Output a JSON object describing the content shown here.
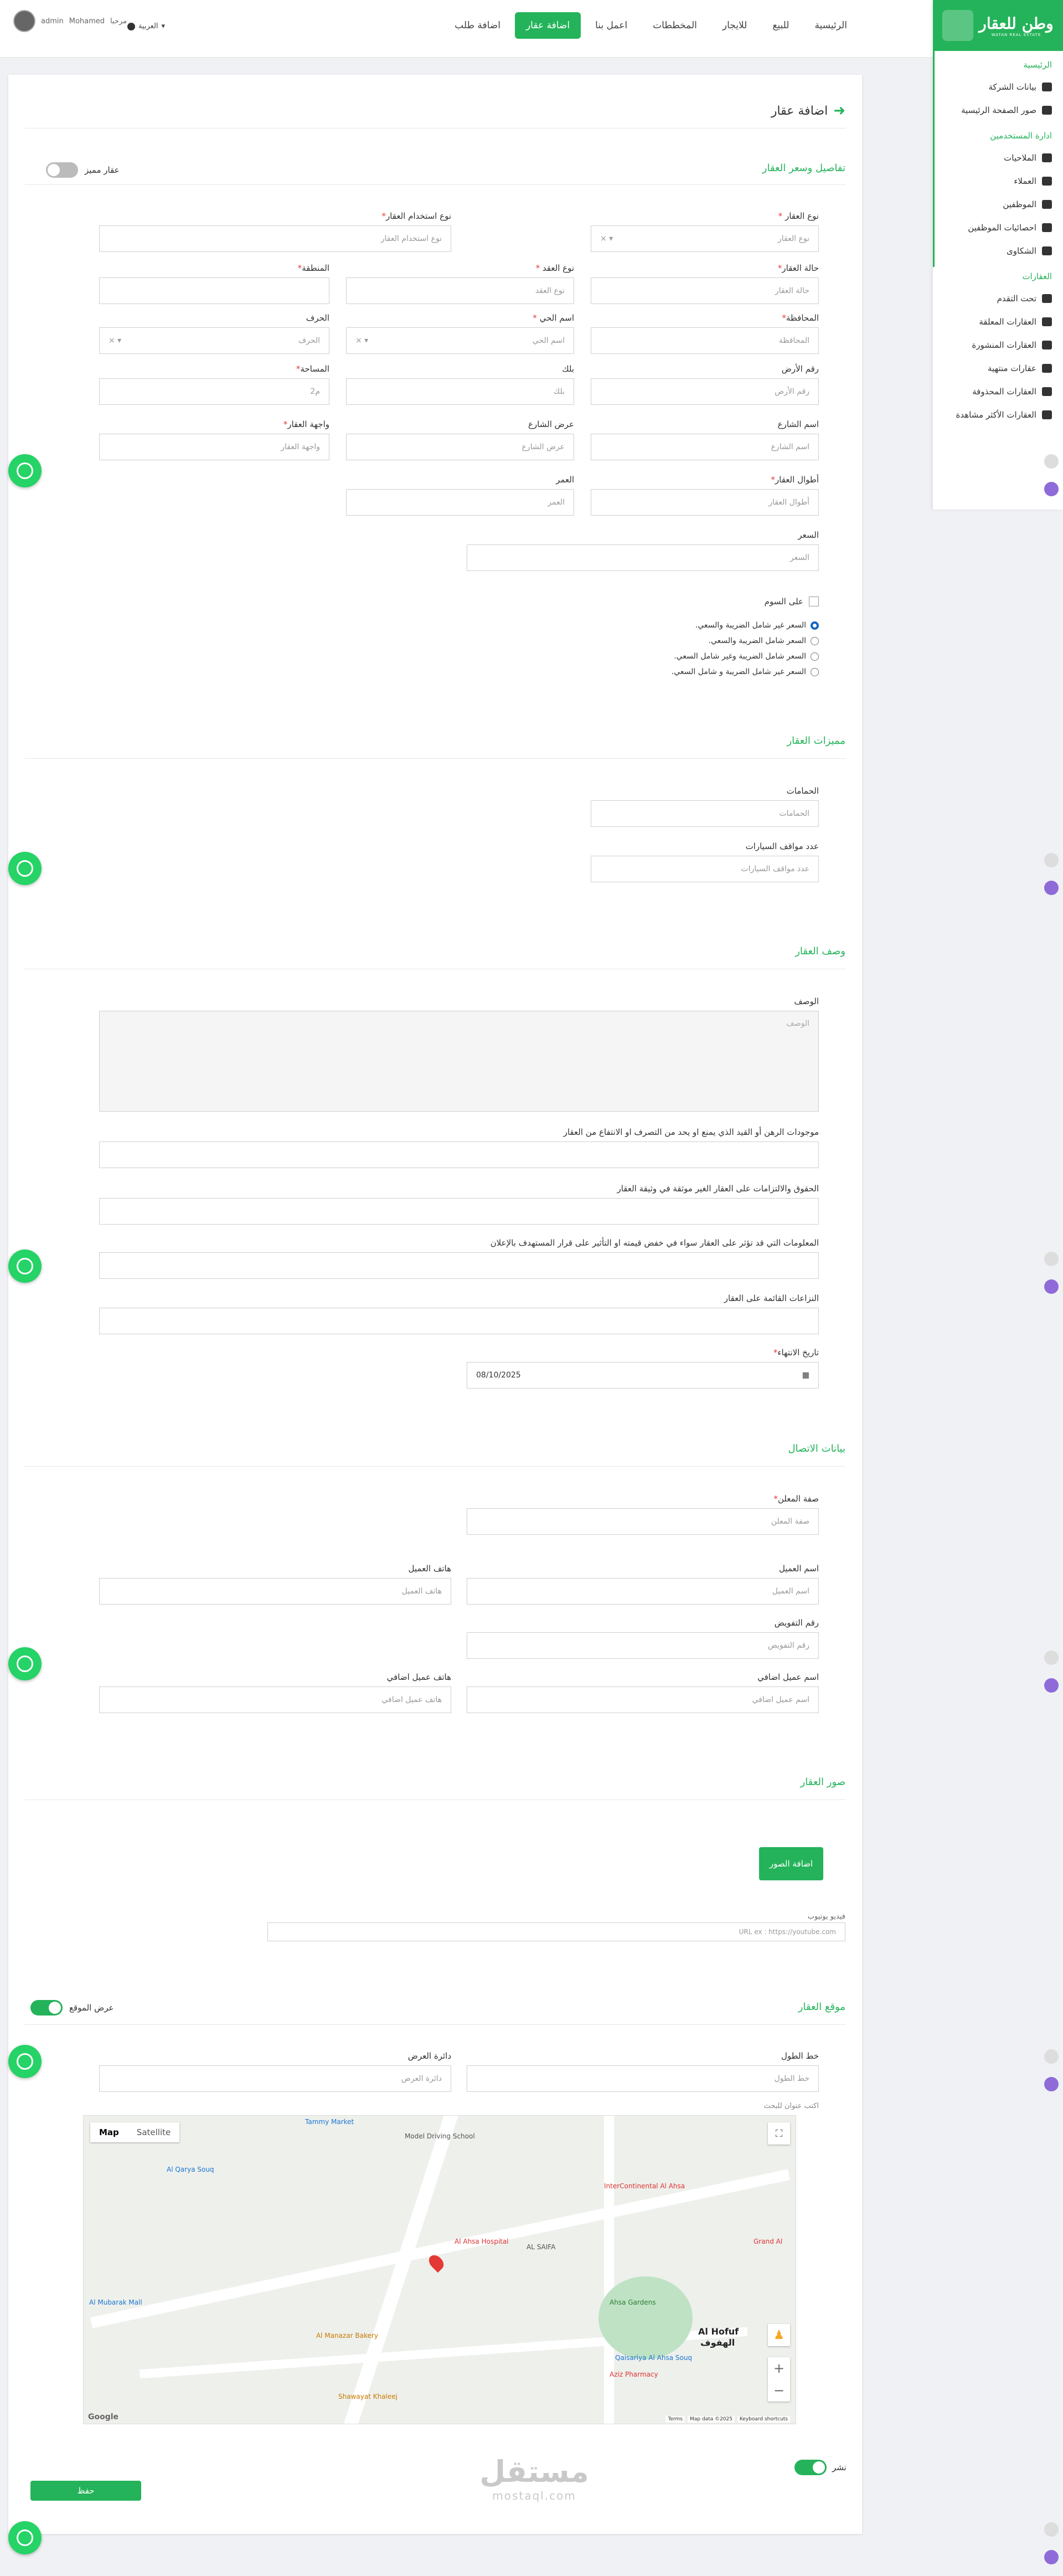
{
  "header": {
    "nav": [
      "الرئيسية",
      "للبيع",
      "للايجار",
      "المخططات",
      "اعمل بنا",
      "اضافة عقار",
      "اضافة طلب"
    ],
    "active_nav": "اضافة عقار",
    "user_greeting": "مرحبا",
    "user_name": "Mohamed",
    "user_role": "admin",
    "language": "العربية"
  },
  "sidebar": {
    "logo_text": "وطن للعقار",
    "logo_sub": "WATAN REAL ESTATE",
    "sections": [
      {
        "title": "الرئيسية",
        "items": [
          "بيانات الشركة",
          "صور الصفحة الرئيسية"
        ]
      },
      {
        "title": "ادارة المستخدمين",
        "items": [
          "الملاحيات",
          "العملاء",
          "الموظفين",
          "احصائيات الموظفين",
          "الشكاوى"
        ]
      },
      {
        "title": "العقارات",
        "items": [
          "تحت التقدم",
          "العقارات المعلقة",
          "العقارات المنشورة",
          "عقارات منتهية",
          "العقارات المحذوفة",
          "العقارات الأكثر مشاهدة"
        ]
      }
    ]
  },
  "page": {
    "title": "اضافة عقار"
  },
  "details": {
    "title": "تفاصيل وسعر العقار",
    "featured_label": "عقار مميز",
    "fields": {
      "property_type": {
        "label": "نوع العقار",
        "placeholder": "نوع العقار"
      },
      "usage_type": {
        "label": "نوع استخدام العقار",
        "placeholder": "نوع استخدام العقار"
      },
      "property_status": {
        "label": "حالة العقار",
        "placeholder": "حالة العقار"
      },
      "contract_type": {
        "label": "نوع العقد",
        "placeholder": "نوع العقد"
      },
      "region": {
        "label": "المنطقة",
        "placeholder": ""
      },
      "governorate": {
        "label": "المحافظة",
        "placeholder": "المحافظة"
      },
      "district": {
        "label": "اسم الحي",
        "placeholder": "اسم الحي"
      },
      "direction": {
        "label": "الحرف",
        "placeholder": "الحرف"
      },
      "land_no": {
        "label": "رقم الأرض",
        "placeholder": "رقم الأرض"
      },
      "block": {
        "label": "بلك",
        "placeholder": "بلك"
      },
      "area": {
        "label": "المساحة",
        "placeholder": "م2"
      },
      "street_name": {
        "label": "اسم الشارع",
        "placeholder": "اسم الشارع"
      },
      "street_width": {
        "label": "عرض الشارع",
        "placeholder": "عرض الشارع"
      },
      "facade": {
        "label": "واجهة العقار",
        "placeholder": "واجهة العقار"
      },
      "lengths": {
        "label": "أطوال العقار",
        "placeholder": "أطوال العقار"
      },
      "age": {
        "label": "العمر",
        "placeholder": "العمر"
      },
      "price": {
        "label": "السعر",
        "placeholder": "السعر"
      }
    },
    "on_bid_label": "على السوم",
    "price_options": [
      "السعر غير شامل الضريبة والسعي.",
      "السعر شامل الضريبة والسعي.",
      "السعر شامل الضريبة وغير شامل السعي.",
      "السعر غير شامل الضريبة و شامل السعي."
    ]
  },
  "features": {
    "title": "مميزات العقار",
    "bathrooms": {
      "label": "الحمامات",
      "placeholder": "الحمامات"
    },
    "parking": {
      "label": "عدد مواقف السيارات",
      "placeholder": "عدد مواقف السيارات"
    }
  },
  "description": {
    "title": "وصف العقار",
    "desc_label": "الوصف",
    "desc_placeholder": "الوصف",
    "q1": "موجودات الرهن أو القيد الذي يمنع او يحد من التصرف او الانتفاع من العقار",
    "q2": "الحقوق والالتزامات على العقار الغير موثقة في وثيقة العقار",
    "q3": "المعلومات التي قد تؤثر على العقار سواء في خفض قيمته او التأثير على قرار المستهدف بالإعلان",
    "q4": "النزاعات القائمة على العقار",
    "expiry_label": "تاريخ الانتهاء",
    "expiry_value": "08/10/2025"
  },
  "contact": {
    "title": "بيانات الاتصال",
    "advertiser_role": {
      "label": "صفة المعلن",
      "placeholder": "صفة المعلن"
    },
    "client_name": {
      "label": "اسم العميل",
      "placeholder": "اسم العميل"
    },
    "client_phone": {
      "label": "هاتف العميل",
      "placeholder": "هاتف العميل"
    },
    "authorization_no": {
      "label": "رقم التفويض",
      "placeholder": "رقم التفويض"
    },
    "extra_client_name": {
      "label": "اسم عميل اضافي",
      "placeholder": "اسم عميل اضافي"
    },
    "extra_client_phone": {
      "label": "هاتف عميل اضافي",
      "placeholder": "هاتف عميل اضافي"
    }
  },
  "images": {
    "title": "صور العقار",
    "add_button": "اضافة الصور",
    "youtube_label": "فيديو يوتيوب",
    "youtube_placeholder": "URL ex : https://youtube.com"
  },
  "location": {
    "title": "موقع العقار",
    "show_location_label": "عرض الموقع",
    "longitude": {
      "label": "خط الطول",
      "placeholder": "خط الطول"
    },
    "latitude": {
      "label": "دائرة العرض",
      "placeholder": "دائرة العرض"
    },
    "address_hint": "اكتب عنوان للبحث",
    "map_types": [
      "Satellite",
      "Map"
    ],
    "map_labels": [
      "Al Hofuf",
      "الهفوف",
      "AL SAIFA",
      "Al Ahsa Hospital",
      "Al Manazar Bakery",
      "InterContinental Al Ahsa",
      "Al Qarya Souq",
      "Tammy Market",
      "Model Driving School",
      "Al Mubarak Mall",
      "Aziz Pharmacy",
      "Shawayat Khaleej",
      "Grand Al",
      "Ahsa Gardens",
      "Qaisariya Al Ahsa Souq",
      "Google"
    ],
    "map_footer": [
      "Keyboard shortcuts",
      "Map data ©2025",
      "Terms"
    ]
  },
  "footer": {
    "publish_label": "نشر",
    "save_button": "حفظ"
  },
  "watermark": {
    "arabic": "مستقل",
    "latin": "mostaql.com"
  },
  "colors": {
    "accent": "#24b35a",
    "text": "#333333",
    "required": "#e53935"
  }
}
